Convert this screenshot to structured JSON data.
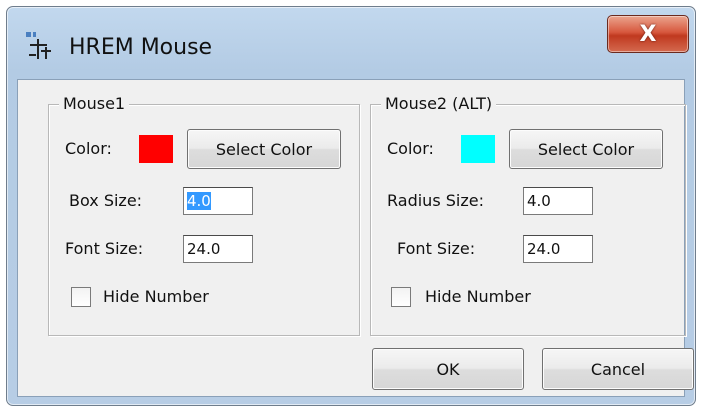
{
  "window": {
    "title": "HREM Mouse",
    "close_glyph": "X",
    "app_icon": "app-icon"
  },
  "mouse1": {
    "legend": "Mouse1",
    "color_label": "Color:",
    "color_value": "#ff0000",
    "select_color_label": "Select Color",
    "size_label": "Box Size:",
    "size_value": "4.0",
    "font_label": "Font Size:",
    "font_value": "24.0",
    "hide_label": "Hide Number",
    "hide_checked": false
  },
  "mouse2": {
    "legend": "Mouse2 (ALT)",
    "color_label": "Color:",
    "color_value": "#00ffff",
    "select_color_label": "Select Color",
    "size_label": "Radius Size:",
    "size_value": "4.0",
    "font_label": "Font Size:",
    "font_value": "24.0",
    "hide_label": "Hide Number",
    "hide_checked": false
  },
  "buttons": {
    "ok": "OK",
    "cancel": "Cancel"
  }
}
